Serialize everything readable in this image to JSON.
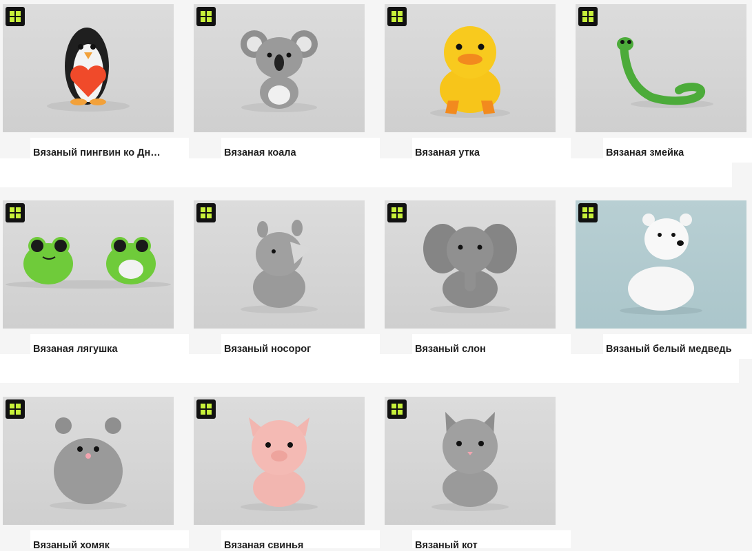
{
  "items": [
    {
      "title": "Вязаный пингвин ко Дн…",
      "icon": "penguin"
    },
    {
      "title": "Вязаная коала",
      "icon": "koala"
    },
    {
      "title": "Вязаная утка",
      "icon": "duck"
    },
    {
      "title": "Вязаная змейка",
      "icon": "snake"
    },
    {
      "title": "Вязаная лягушка",
      "icon": "frog"
    },
    {
      "title": "Вязаный носорог",
      "icon": "rhino"
    },
    {
      "title": "Вязаный слон",
      "icon": "elephant"
    },
    {
      "title": "Вязаный белый медведь",
      "icon": "polar-bear"
    },
    {
      "title": "Вязаный хомяк",
      "icon": "hamster"
    },
    {
      "title": "Вязаная свинья",
      "icon": "pig"
    },
    {
      "title": "Вязаный кот",
      "icon": "cat"
    }
  ],
  "colors": {
    "badge_bg": "#111111",
    "badge_logo": "#c7f03a"
  }
}
